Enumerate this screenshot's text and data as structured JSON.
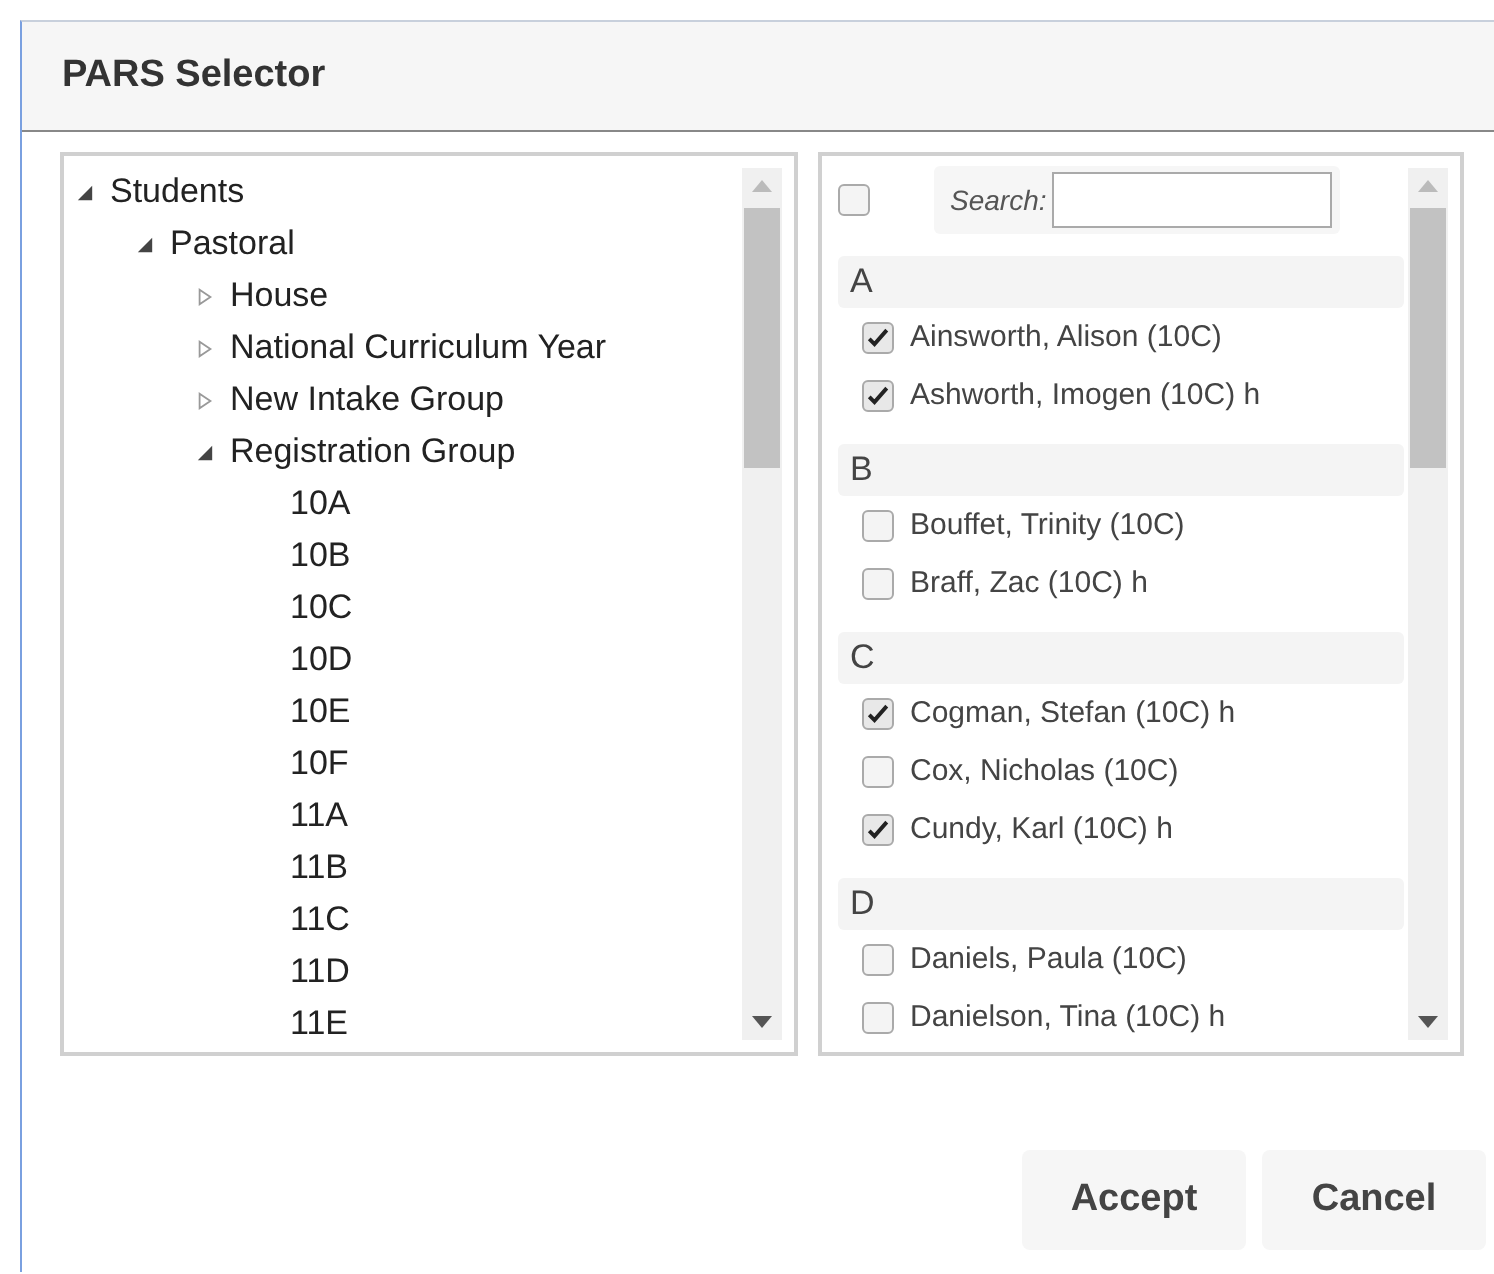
{
  "window": {
    "title": "PARS Selector"
  },
  "tree": [
    {
      "label": "Students",
      "expanded": true,
      "children": [
        {
          "label": "Pastoral",
          "expanded": true,
          "children": [
            {
              "label": "House",
              "expanded": false
            },
            {
              "label": "National Curriculum Year",
              "expanded": false
            },
            {
              "label": "New Intake Group",
              "expanded": false
            },
            {
              "label": "Registration Group",
              "expanded": true,
              "children": [
                {
                  "label": "10A"
                },
                {
                  "label": "10B"
                },
                {
                  "label": "10C"
                },
                {
                  "label": "10D"
                },
                {
                  "label": "10E"
                },
                {
                  "label": "10F"
                },
                {
                  "label": "11A"
                },
                {
                  "label": "11B"
                },
                {
                  "label": "11C"
                },
                {
                  "label": "11D"
                },
                {
                  "label": "11E"
                }
              ]
            }
          ]
        }
      ]
    }
  ],
  "select_all": {
    "checked": false
  },
  "search": {
    "label": "Search:"
  },
  "groups": [
    {
      "letter": "A",
      "students": [
        {
          "name": "Ainsworth, Alison (10C)",
          "checked": true
        },
        {
          "name": "Ashworth, Imogen (10C) h",
          "checked": true
        }
      ]
    },
    {
      "letter": "B",
      "students": [
        {
          "name": "Bouffet, Trinity (10C)",
          "checked": false
        },
        {
          "name": "Braff, Zac (10C) h",
          "checked": false
        }
      ]
    },
    {
      "letter": "C",
      "students": [
        {
          "name": "Cogman, Stefan (10C) h",
          "checked": true
        },
        {
          "name": "Cox, Nicholas (10C)",
          "checked": false
        },
        {
          "name": "Cundy, Karl (10C) h",
          "checked": true
        }
      ]
    },
    {
      "letter": "D",
      "students": [
        {
          "name": "Daniels, Paula (10C)",
          "checked": false
        },
        {
          "name": "Danielson, Tina (10C) h",
          "checked": false
        }
      ]
    }
  ],
  "buttons": [
    "Accept",
    "Cancel"
  ]
}
